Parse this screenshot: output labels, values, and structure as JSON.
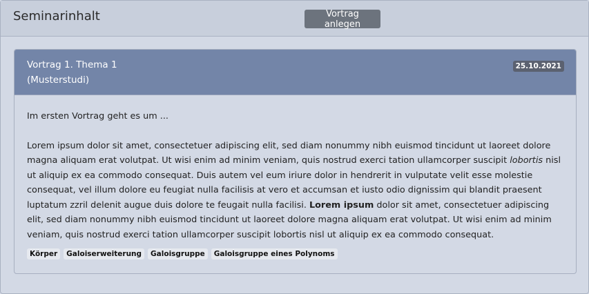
{
  "header": {
    "title": "Seminarinhalt",
    "create_button_label": "Vortrag anlegen"
  },
  "talk": {
    "title": "Vortrag 1. Thema 1",
    "author": "(Musterstudi)",
    "date": "25.10.2021",
    "intro": "Im ersten Vortrag geht es um ...",
    "body_parts": {
      "p1": "Lorem ipsum dolor sit amet, consectetuer adipiscing elit, sed diam nonummy nibh euismod tincidunt ut laoreet dolore magna aliquam erat volutpat. Ut wisi enim ad minim veniam, quis nostrud exerci tation ullamcorper suscipit ",
      "italic": "lobortis",
      "p2": " nisl ut aliquip ex ea commodo consequat. Duis autem vel eum iriure dolor in hendrerit in vulputate velit esse molestie consequat, vel illum dolore eu feugiat nulla facilisis at vero et accumsan et iusto odio dignissim qui blandit praesent luptatum zzril delenit augue duis dolore te feugait nulla facilisi. ",
      "bold": "Lorem ipsum",
      "p3": " dolor sit amet, consectetuer adipiscing elit, sed diam nonummy nibh euismod tincidunt ut laoreet dolore magna aliquam erat volutpat. Ut wisi enim ad minim veniam, quis nostrud exerci tation ullamcorper suscipit lobortis nisl ut aliquip ex ea commodo consequat."
    },
    "tags": [
      "Körper",
      "Galoiserweiterung",
      "Galoisgruppe",
      "Galoisgruppe eines Polynoms"
    ]
  }
}
